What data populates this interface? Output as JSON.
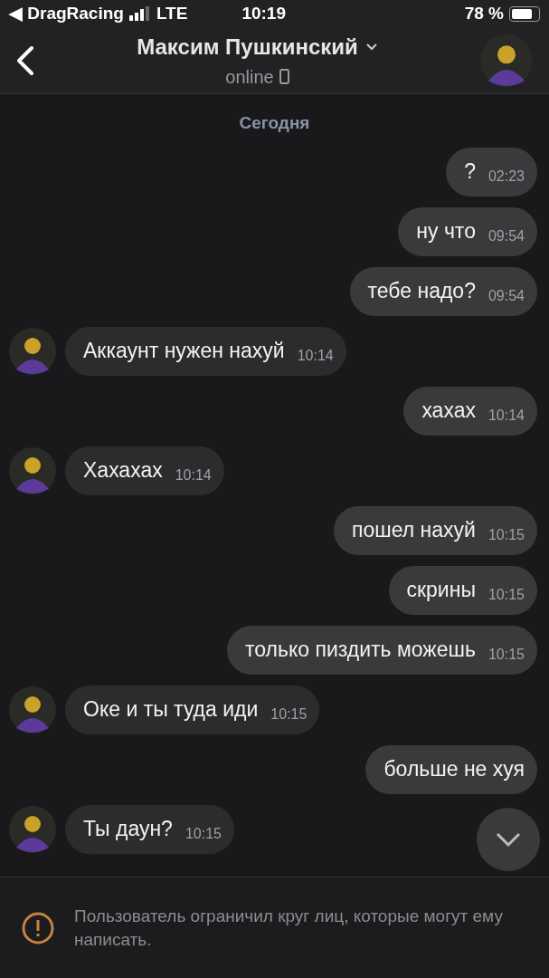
{
  "status_bar": {
    "back_app": "◀ DragRacing",
    "network": "LTE",
    "time": "10:19",
    "battery": "78 %"
  },
  "header": {
    "name": "Максим Пушкинский",
    "status": "online"
  },
  "date_label": "Сегодня",
  "messages": [
    {
      "kind": "outgoing",
      "text": "?",
      "time": "02:23"
    },
    {
      "kind": "outgoing",
      "text": "ну что",
      "time": "09:54"
    },
    {
      "kind": "outgoing",
      "text": "тебе надо?",
      "time": "09:54"
    },
    {
      "kind": "incoming",
      "text": "Аккаунт нужен нахуй",
      "time": "10:14"
    },
    {
      "kind": "outgoing",
      "text": "хахах",
      "time": "10:14"
    },
    {
      "kind": "incoming",
      "text": "Хахахах",
      "time": "10:14"
    },
    {
      "kind": "outgoing",
      "text": "пошел нахуй",
      "time": "10:15"
    },
    {
      "kind": "outgoing",
      "text": "скрины",
      "time": "10:15"
    },
    {
      "kind": "outgoing",
      "text": "только пиздить можешь",
      "time": "10:15"
    },
    {
      "kind": "incoming",
      "text": "Оке и ты туда иди",
      "time": "10:15"
    },
    {
      "kind": "outgoing",
      "text": "больше не хуя"
    },
    {
      "kind": "incoming",
      "text": "Ты даун?",
      "time": "10:15"
    }
  ],
  "notice": "Пользователь ограничил круг лиц, которые могут ему написать."
}
